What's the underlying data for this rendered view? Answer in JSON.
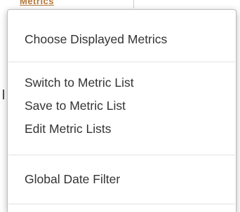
{
  "background": {
    "fragment_text": "Metrics"
  },
  "menu": {
    "groups": [
      {
        "items": [
          {
            "label": "Choose Displayed Metrics"
          }
        ]
      },
      {
        "items": [
          {
            "label": "Switch to Metric List"
          },
          {
            "label": "Save to Metric List"
          },
          {
            "label": "Edit Metric Lists"
          }
        ]
      },
      {
        "items": [
          {
            "label": "Global Date Filter"
          }
        ]
      }
    ]
  },
  "colors": {
    "menu_text": "#333333",
    "separator": "#e2e2e2",
    "menu_border": "#bdbdbd",
    "background_link": "#b4783a"
  }
}
